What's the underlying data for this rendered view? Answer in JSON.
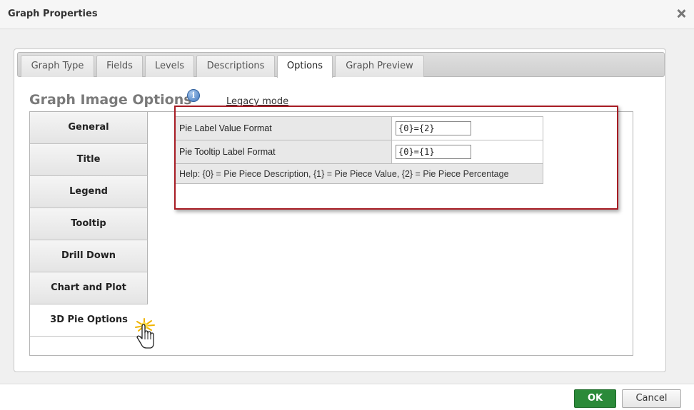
{
  "dialog": {
    "title": "Graph Properties",
    "close_icon": "close-icon"
  },
  "tabs": [
    {
      "label": "Graph Type"
    },
    {
      "label": "Fields"
    },
    {
      "label": "Levels"
    },
    {
      "label": "Descriptions"
    },
    {
      "label": "Options",
      "active": true
    },
    {
      "label": "Graph Preview"
    }
  ],
  "section": {
    "title": "Graph Image Options",
    "info_icon": "info-icon",
    "legacy_link": "Legacy mode"
  },
  "side_nav": [
    {
      "label": "General"
    },
    {
      "label": "Title"
    },
    {
      "label": "Legend"
    },
    {
      "label": "Tooltip"
    },
    {
      "label": "Drill Down"
    },
    {
      "label": "Chart and Plot"
    },
    {
      "label": "3D Pie Options",
      "active": true
    }
  ],
  "pie_options": {
    "label_value_format": {
      "label": "Pie Label Value Format",
      "value": "{0}={2}"
    },
    "tooltip_label_format": {
      "label": "Pie Tooltip Label Format",
      "value": "{0}={1}"
    },
    "help": "Help: {0} = Pie Piece Description, {1} = Pie Piece Value, {2} = Pie Piece Percentage"
  },
  "footer": {
    "ok_label": "OK",
    "cancel_label": "Cancel"
  },
  "colors": {
    "ok_button": "#2b8a39",
    "highlight_border": "#a71c24",
    "active_tab_bg": "#ffffff"
  }
}
